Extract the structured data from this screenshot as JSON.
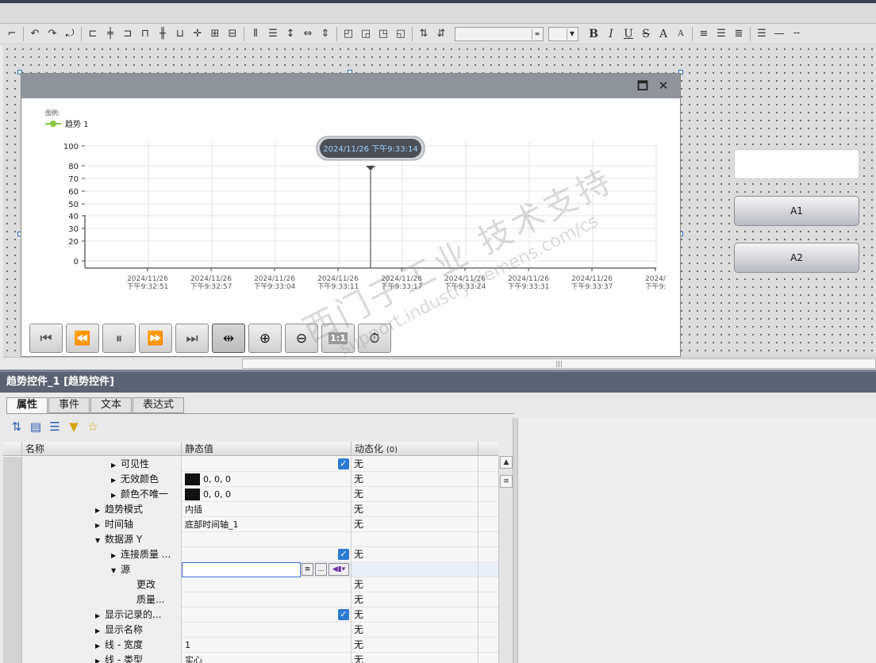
{
  "toolbar": {
    "font_name_value": "",
    "font_size_value": "",
    "bold_label": "B",
    "italic_label": "I",
    "underline_label": "U",
    "strike_label": "S",
    "grow_font_label": "A",
    "shrink_font_label": "A"
  },
  "trend": {
    "legend_title": "图例:",
    "legend_series": "趋势 1",
    "series_color": "#8dc63f",
    "ruler_tooltip": "2024/11/26 下午9:33:14",
    "y_ticks": [
      "100",
      "80",
      "70",
      "60",
      "50",
      "40",
      "30",
      "20",
      "0"
    ],
    "x_ticks": [
      {
        "date": "2024/11/26",
        "time": "下午9:32:51"
      },
      {
        "date": "2024/11/26",
        "time": "下午9:32:57"
      },
      {
        "date": "2024/11/26",
        "time": "下午9:33:04"
      },
      {
        "date": "2024/11/26",
        "time": "下午9:33:11"
      },
      {
        "date": "2024/11/26",
        "time": "下午9:33:17"
      },
      {
        "date": "2024/11/26",
        "time": "下午9:33:24"
      },
      {
        "date": "2024/11/26",
        "time": "下午9:33:31"
      },
      {
        "date": "2024/11/26",
        "time": "下午9:33:37"
      },
      {
        "date": "2024/",
        "time": "下午9:"
      }
    ],
    "controls": [
      {
        "name": "first-icon",
        "glyph": "⏮"
      },
      {
        "name": "rewind-icon",
        "glyph": "⏪"
      },
      {
        "name": "pause-icon",
        "glyph": "⏸"
      },
      {
        "name": "fast-forward-icon",
        "glyph": "⏩"
      },
      {
        "name": "last-icon",
        "glyph": "⏭"
      },
      {
        "name": "ruler-icon",
        "glyph": "⇹"
      },
      {
        "name": "zoom-in-icon",
        "glyph": "⊕"
      },
      {
        "name": "zoom-out-icon",
        "glyph": "⊖"
      },
      {
        "name": "original-size-icon",
        "glyph": "1:1"
      },
      {
        "name": "stopwatch-icon",
        "glyph": "⏱"
      }
    ]
  },
  "side": {
    "button_a1": "A1",
    "button_a2": "A2"
  },
  "inspector": {
    "title": "趋势控件_1 [趋势控件]",
    "tabs": [
      "属性",
      "事件",
      "文本",
      "表达式"
    ],
    "columns": {
      "name": "名称",
      "static": "静态值",
      "dynamic": "动态化",
      "dynamic_count": "(0)"
    },
    "rows": [
      {
        "indent": 2,
        "arrow": "▶",
        "name": "可见性",
        "value": "",
        "checkbox": true,
        "dyn": "无"
      },
      {
        "indent": 2,
        "arrow": "▶",
        "name": "无效颜色",
        "value": "0, 0, 0",
        "swatch": "#111111",
        "dyn": "无"
      },
      {
        "indent": 2,
        "arrow": "▶",
        "name": "颜色不唯一",
        "value": "0, 0, 0",
        "swatch": "#111111",
        "dyn": "无"
      },
      {
        "indent": 1,
        "arrow": "▶",
        "name": "趋势模式",
        "value": "内插",
        "dyn": "无"
      },
      {
        "indent": 1,
        "arrow": "▶",
        "name": "时间轴",
        "value": "底部时间轴_1",
        "dyn": "无"
      },
      {
        "indent": 1,
        "arrow": "▼",
        "name": "数据源 Y",
        "value": "",
        "dyn": ""
      },
      {
        "indent": 2,
        "arrow": "▶",
        "name": "连接质量 ...",
        "value": "",
        "checkbox": true,
        "dyn": "无"
      },
      {
        "indent": 2,
        "arrow": "▼",
        "name": "源",
        "value": "",
        "source_input": true,
        "dyn": ""
      },
      {
        "indent": 3,
        "arrow": "",
        "name": "更改",
        "value": "",
        "dyn": "无"
      },
      {
        "indent": 3,
        "arrow": "",
        "name": "质量...",
        "value": "",
        "dyn": "无"
      },
      {
        "indent": 1,
        "arrow": "▶",
        "name": "显示记录的...",
        "value": "",
        "checkbox": true,
        "dyn": "无"
      },
      {
        "indent": 1,
        "arrow": "▶",
        "name": "显示名称",
        "value": "",
        "dyn": "无"
      },
      {
        "indent": 1,
        "arrow": "▶",
        "name": "线 - 宽度",
        "value": "1",
        "dyn": "无"
      },
      {
        "indent": 1,
        "arrow": "▶",
        "name": "线 - 类型",
        "value": "实心",
        "dyn": "无"
      }
    ]
  },
  "watermark": {
    "line1": "西门子工业 技术支持",
    "line2": "support.industry.siemens.com/cs"
  }
}
